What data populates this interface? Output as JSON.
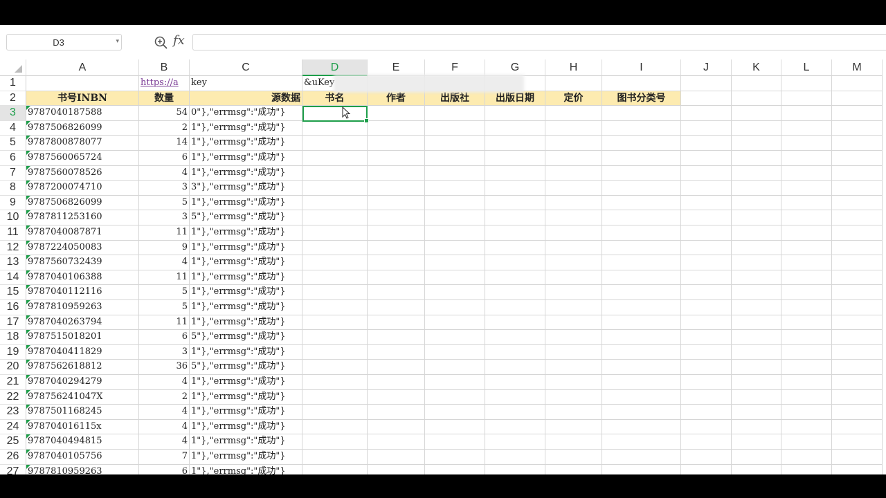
{
  "name_box": {
    "value": "D3"
  },
  "formula": {
    "fx_label": "fx",
    "value": ""
  },
  "columns": [
    "A",
    "B",
    "C",
    "D",
    "E",
    "F",
    "G",
    "H",
    "I",
    "J",
    "K",
    "L",
    "M"
  ],
  "active_cell": "D3",
  "row1": {
    "B": "https://a",
    "C": "key",
    "D": "&uKey"
  },
  "headers": {
    "A": "书号INBN",
    "B": "数量",
    "C": "源数据",
    "D": "书名",
    "E": "作者",
    "F": "出版社",
    "G": "出版日期",
    "H": "定价",
    "I": "图书分类号"
  },
  "rows": [
    {
      "n": "3",
      "isbn": "9787040187588",
      "qty": "54",
      "src": "0\"},\"errmsg\":\"成功\"}"
    },
    {
      "n": "4",
      "isbn": "9787506826099",
      "qty": "2",
      "src": "1\"},\"errmsg\":\"成功\"}"
    },
    {
      "n": "5",
      "isbn": "9787800878077",
      "qty": "14",
      "src": "1\"},\"errmsg\":\"成功\"}"
    },
    {
      "n": "6",
      "isbn": "9787560065724",
      "qty": "6",
      "src": "1\"},\"errmsg\":\"成功\"}"
    },
    {
      "n": "7",
      "isbn": "9787560078526",
      "qty": "4",
      "src": "1\"},\"errmsg\":\"成功\"}"
    },
    {
      "n": "8",
      "isbn": "9787200074710",
      "qty": "3",
      "src": "3\"},\"errmsg\":\"成功\"}"
    },
    {
      "n": "9",
      "isbn": "9787506826099",
      "qty": "5",
      "src": "1\"},\"errmsg\":\"成功\"}"
    },
    {
      "n": "10",
      "isbn": "9787811253160",
      "qty": "3",
      "src": "5\"},\"errmsg\":\"成功\"}"
    },
    {
      "n": "11",
      "isbn": "9787040087871",
      "qty": "11",
      "src": "1\"},\"errmsg\":\"成功\"}"
    },
    {
      "n": "12",
      "isbn": "9787224050083",
      "qty": "9",
      "src": "1\"},\"errmsg\":\"成功\"}"
    },
    {
      "n": "13",
      "isbn": "9787560732439",
      "qty": "4",
      "src": "1\"},\"errmsg\":\"成功\"}"
    },
    {
      "n": "14",
      "isbn": "9787040106388",
      "qty": "11",
      "src": "1\"},\"errmsg\":\"成功\"}"
    },
    {
      "n": "15",
      "isbn": "9787040112116",
      "qty": "5",
      "src": "1\"},\"errmsg\":\"成功\"}"
    },
    {
      "n": "16",
      "isbn": "9787810959263",
      "qty": "5",
      "src": "1\"},\"errmsg\":\"成功\"}"
    },
    {
      "n": "17",
      "isbn": "9787040263794",
      "qty": "11",
      "src": "1\"},\"errmsg\":\"成功\"}"
    },
    {
      "n": "18",
      "isbn": "9787515018201",
      "qty": "6",
      "src": "5\"},\"errmsg\":\"成功\"}"
    },
    {
      "n": "19",
      "isbn": "9787040411829",
      "qty": "3",
      "src": "1\"},\"errmsg\":\"成功\"}"
    },
    {
      "n": "20",
      "isbn": "9787562618812",
      "qty": "36",
      "src": "5\"},\"errmsg\":\"成功\"}"
    },
    {
      "n": "21",
      "isbn": "9787040294279",
      "qty": "4",
      "src": "1\"},\"errmsg\":\"成功\"}"
    },
    {
      "n": "22",
      "isbn": "978756241047X",
      "qty": "2",
      "src": "1\"},\"errmsg\":\"成功\"}"
    },
    {
      "n": "23",
      "isbn": "9787501168245",
      "qty": "4",
      "src": "1\"},\"errmsg\":\"成功\"}"
    },
    {
      "n": "24",
      "isbn": "978704016115x",
      "qty": "4",
      "src": "1\"},\"errmsg\":\"成功\"}"
    },
    {
      "n": "25",
      "isbn": "9787040494815",
      "qty": "4",
      "src": "1\"},\"errmsg\":\"成功\"}"
    },
    {
      "n": "26",
      "isbn": "9787040105756",
      "qty": "7",
      "src": "1\"},\"errmsg\":\"成功\"}"
    },
    {
      "n": "27",
      "isbn": "9787810959263",
      "qty": "6",
      "src": "1\"},\"errmsg\":\"成功\"}"
    }
  ]
}
